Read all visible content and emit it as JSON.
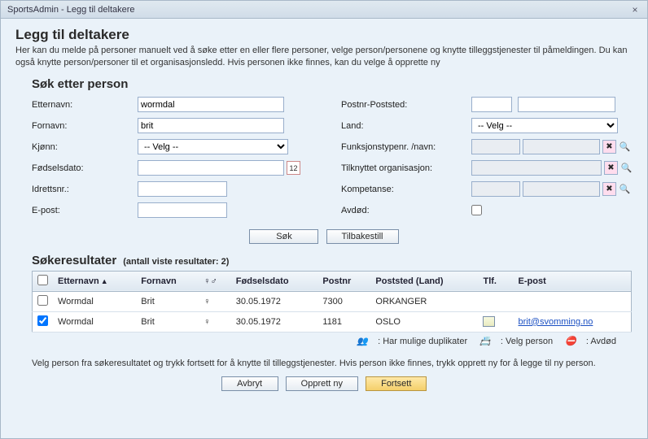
{
  "window": {
    "title": "SportsAdmin - Legg til deltakere"
  },
  "page": {
    "heading": "Legg til deltakere",
    "intro": "Her kan du melde på personer manuelt ved å søke etter en eller flere personer, velge person/personene og knytte tilleggstjenester til påmeldingen. Du kan også knytte person/personer til et organisasjonsledd. Hvis personen ikke finnes, kan du velge å opprette ny"
  },
  "search": {
    "heading": "Søk etter person",
    "labels": {
      "etternavn": "Etternavn:",
      "fornavn": "Fornavn:",
      "kjonn": "Kjønn:",
      "fodselsdato": "Fødselsdato:",
      "idrettsnr": "Idrettsnr.:",
      "epost": "E-post:",
      "postnr": "Postnr-Poststed:",
      "land": "Land:",
      "funksjon": "Funksjonstypenr. /navn:",
      "org": "Tilknyttet organisasjon:",
      "kompetanse": "Kompetanse:",
      "avdod": "Avdød:"
    },
    "values": {
      "etternavn": "wormdal",
      "fornavn": "brit",
      "kjonn": "-- Velg --",
      "land": "-- Velg --"
    },
    "buttons": {
      "sok": "Søk",
      "tilbakestill": "Tilbakestill"
    }
  },
  "results": {
    "heading": "Søkeresultater",
    "count_text": "(antall viste resultater: 2)",
    "headers": {
      "etternavn": "Etternavn",
      "fornavn": "Fornavn",
      "kjonn": "♀♂",
      "fodselsdato": "Fødselsdato",
      "postnr": "Postnr",
      "poststed": "Poststed (Land)",
      "tlf": "Tlf.",
      "epost": "E-post"
    },
    "rows": [
      {
        "checked": false,
        "etternavn": "Wormdal",
        "fornavn": "Brit",
        "kjonn": "♀",
        "fodselsdato": "30.05.1972",
        "postnr": "7300",
        "poststed": "ORKANGER",
        "tlf": "",
        "epost": ""
      },
      {
        "checked": true,
        "etternavn": "Wormdal",
        "fornavn": "Brit",
        "kjonn": "♀",
        "fodselsdato": "30.05.1972",
        "postnr": "1181",
        "poststed": "OSLO",
        "tlf": "card",
        "epost": "brit@svomming.no"
      }
    ],
    "legend": {
      "dup": ": Har mulige duplikater",
      "sel": ": Velg person",
      "dead": ": Avdød"
    }
  },
  "help2": "Velg person fra søkeresultatet og trykk fortsett for å knytte til tilleggstjenester. Hvis person ikke finnes, trykk opprett ny for å legge til ny person.",
  "footer": {
    "avbryt": "Avbryt",
    "opprett": "Opprett ny",
    "fortsett": "Fortsett"
  }
}
